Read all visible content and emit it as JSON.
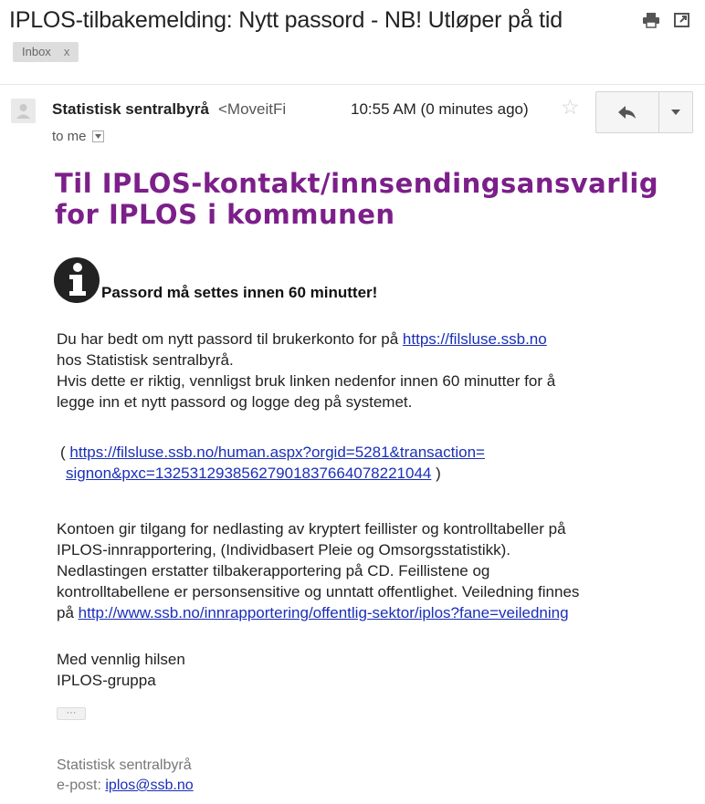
{
  "header": {
    "subject": "IPLOS-tilbakemelding: Nytt passord - NB! Utløper på tid",
    "label": "Inbox",
    "label_remove": "x",
    "icons": [
      "print-icon",
      "new-window-icon"
    ]
  },
  "message": {
    "sender_name": "Statistisk sentralbyrå",
    "sender_email": "<MoveitFi",
    "timestamp": "10:55 AM (0 minutes ago)",
    "recipient": "to me",
    "star": "☆"
  },
  "body": {
    "heading": "Til IPLOS-kontakt/innsendingsansvarlig for IPLOS i kommunen",
    "info_notice": "Passord må settes innen 60 minutter!",
    "p1_prefix": "Du har bedt om nytt passord til brukerkonto for  på ",
    "p1_link": "https://filsluse.ssb.no",
    "p1_line2": "hos Statistisk sentralbyrå.",
    "p1_line3": "Hvis dette er riktig, vennligst bruk linken nedenfor innen 60 minutter for å",
    "p1_line4": "legge inn et nytt passord og logge deg på systemet.",
    "reset_open": "( ",
    "reset_link_line1": "https://filsluse.ssb.no/human.aspx?orgid=5281&transaction=",
    "reset_link_line2": "signon&pxc=132531293856279018376640782210​44",
    "reset_close": " )",
    "p3_line1": "Kontoen gir tilgang for nedlasting av kryptert feillister og kontrolltabeller på",
    "p3_line2": "IPLOS-innrapportering, (Individbasert Pleie og Omsorgsstatistikk).",
    "p3_line3": "Nedlastingen erstatter tilbakerapportering på CD. Feillistene og",
    "p3_line4": "kontrolltabellene er personsensitive og unntatt offentlighet. Veiledning finnes",
    "p3_prefix5": "på ",
    "p3_link": "http://www.ssb.no/innrapportering/offentlig-sektor/iplos?fane=veiledning",
    "closing": "Med vennlig hilsen",
    "team": "IPLOS-gruppa",
    "expand_dots": "···",
    "sig_name": "Statistisk sentralbyrå",
    "sig_email_prefix": "e-post: ",
    "sig_email": "iplos@ssb.no"
  }
}
